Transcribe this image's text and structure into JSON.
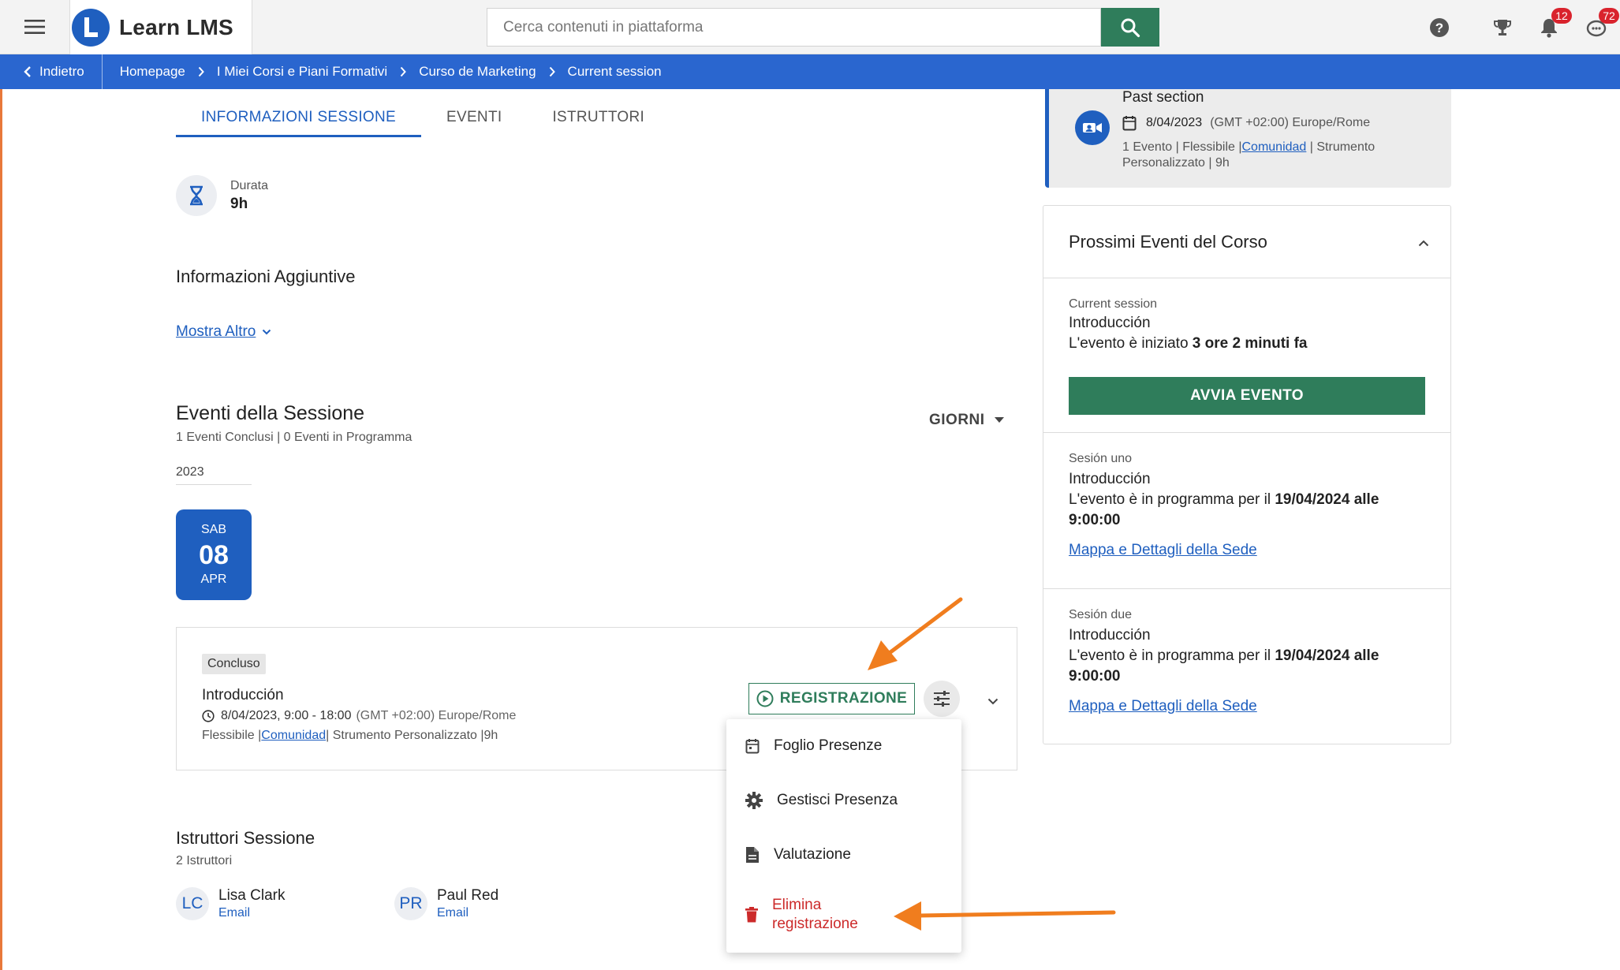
{
  "app": {
    "title": "Learn LMS"
  },
  "search": {
    "placeholder": "Cerca contenuti in piattaforma"
  },
  "notifications": {
    "bell_count": "12",
    "chat_count": "72"
  },
  "breadcrumb": {
    "back_label": "Indietro",
    "items": [
      "Homepage",
      "I Miei Corsi e Piani Formativi",
      "Curso de Marketing",
      "Current session"
    ]
  },
  "tabs": [
    "INFORMAZIONI SESSIONE",
    "EVENTI",
    "ISTRUTTORI"
  ],
  "duration": {
    "label": "Durata",
    "value": "9h"
  },
  "additional_info": {
    "title": "Informazioni Aggiuntive",
    "show_more": "Mostra Altro"
  },
  "session_events": {
    "title": "Eventi della Sessione",
    "subtitle": "1 Eventi Conclusi | 0 Eventi in Programma",
    "view_select": "GIORNI",
    "year": "2023",
    "date_chip": {
      "weekday": "SAB",
      "day": "08",
      "month": "APR"
    },
    "event": {
      "status": "Concluso",
      "name": "Introducción",
      "datetime": "8/04/2023, 9:00 - 18:00",
      "timezone": "(GMT +02:00) Europe/Rome",
      "meta_prefix": "Flessibile |",
      "meta_link": "Comunidad",
      "meta_suffix": "| Strumento Personalizzato |9h",
      "recording_button": "REGISTRAZIONE"
    },
    "menu": {
      "items": [
        "Foglio Presenze",
        "Gestisci Presenza",
        "Valutazione"
      ],
      "delete_line1": "Elimina",
      "delete_line2": "registrazione"
    }
  },
  "instructors": {
    "title": "Istruttori Sessione",
    "subtitle": "2 Istruttori",
    "list": [
      {
        "initials": "LC",
        "name": "Lisa Clark",
        "email_label": "Email"
      },
      {
        "initials": "PR",
        "name": "Paul Red",
        "email_label": "Email"
      }
    ]
  },
  "past_section": {
    "title": "Past section",
    "date": "8/04/2023",
    "timezone": "(GMT +02:00) Europe/Rome",
    "meta_prefix": "1 Evento | Flessibile |",
    "meta_link": "Comunidad",
    "meta_suffix": "| Strumento Personalizzato | 9h"
  },
  "upcoming": {
    "title": "Prossimi Eventi del Corso",
    "current": {
      "label": "Current session",
      "name": "Introducción",
      "text_prefix": "L'evento è iniziato",
      "text_bold": "3 ore 2 minuti fa",
      "button": "AVVIA EVENTO"
    },
    "items": [
      {
        "label": "Sesión uno",
        "name": "Introducción",
        "text_prefix": "L'evento è in programma per il",
        "text_bold": "19/04/2024 alle 9:00:00",
        "link": "Mappa e Dettagli della Sede"
      },
      {
        "label": "Sesión due",
        "name": "Introducción",
        "text_prefix": "L'evento è in programma per il",
        "text_bold": "19/04/2024 alle 9:00:00",
        "link": "Mappa e Dettagli della Sede"
      }
    ]
  },
  "colors": {
    "primary": "#1f5fbf",
    "green": "#2f7d5b",
    "danger": "#cc2a2a",
    "annotation": "#f07d1e"
  }
}
